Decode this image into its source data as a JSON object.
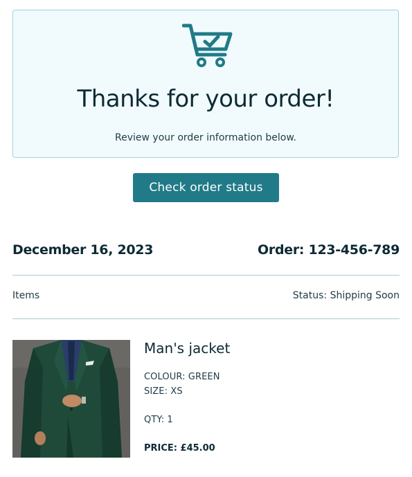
{
  "hero": {
    "icon": "shopping-cart-check-icon",
    "title": "Thanks for your order!",
    "subtitle": "Review your order information below."
  },
  "actions": {
    "check_status_label": "Check order status"
  },
  "order": {
    "date": "December 16, 2023",
    "number_label": "Order: 123-456-789",
    "items_label": "Items",
    "status_label": "Status: Shipping Soon"
  },
  "items": [
    {
      "name": "Man's jacket",
      "colour": "COLOUR: GREEN",
      "size": "SIZE: XS",
      "qty": "QTY: 1",
      "price": "PRICE: £45.00",
      "image": "green-suit-photo"
    }
  ],
  "colors": {
    "accent": "#217a87",
    "hero_bg": "#f1fbfd",
    "hero_border": "#9fd0dc",
    "text_dark": "#0d2a34"
  }
}
